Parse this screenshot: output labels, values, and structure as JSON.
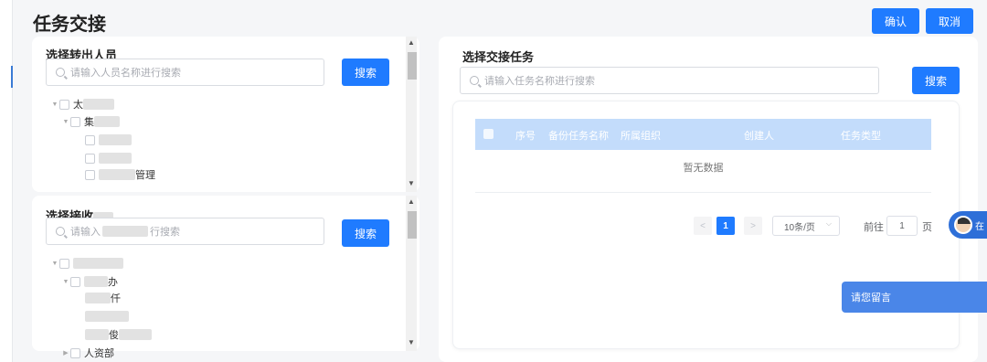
{
  "header": {
    "title": "任务交接",
    "confirm_label": "确认",
    "cancel_label": "取消"
  },
  "transfer_out": {
    "title": "选择转出人员",
    "search_placeholder": "请输入人员名称进行搜索",
    "search_button": "搜索",
    "tree": [
      {
        "visible_text": "太"
      },
      {
        "visible_text": "集"
      },
      {
        "visible_text": ""
      },
      {
        "visible_text": ""
      },
      {
        "visible_text": "管理"
      }
    ]
  },
  "receive": {
    "title": "选择接收",
    "search_placeholder_prefix": "请输入",
    "search_placeholder_suffix": "行搜索",
    "search_button": "搜索",
    "tree": [
      {
        "visible_text": ""
      },
      {
        "visible_text": "办"
      },
      {
        "visible_text": "仟"
      },
      {
        "visible_text": ""
      },
      {
        "visible_text": "俊"
      },
      {
        "visible_text": "人资部"
      }
    ]
  },
  "tasks": {
    "title": "选择交接任务",
    "search_placeholder": "请输入任务名称进行搜索",
    "search_button": "搜索",
    "columns": [
      "序号",
      "备份任务名称",
      "所属组织",
      "创建人",
      "任务类型"
    ],
    "empty_text": "暂无数据",
    "pagination": {
      "prev": "<",
      "current_page": "1",
      "next": ">",
      "page_size": "10条/页",
      "goto_prefix": "前往",
      "goto_value": "1",
      "goto_suffix": "页"
    }
  },
  "chat": {
    "widget_label": "在",
    "message_label": "请您留言"
  }
}
